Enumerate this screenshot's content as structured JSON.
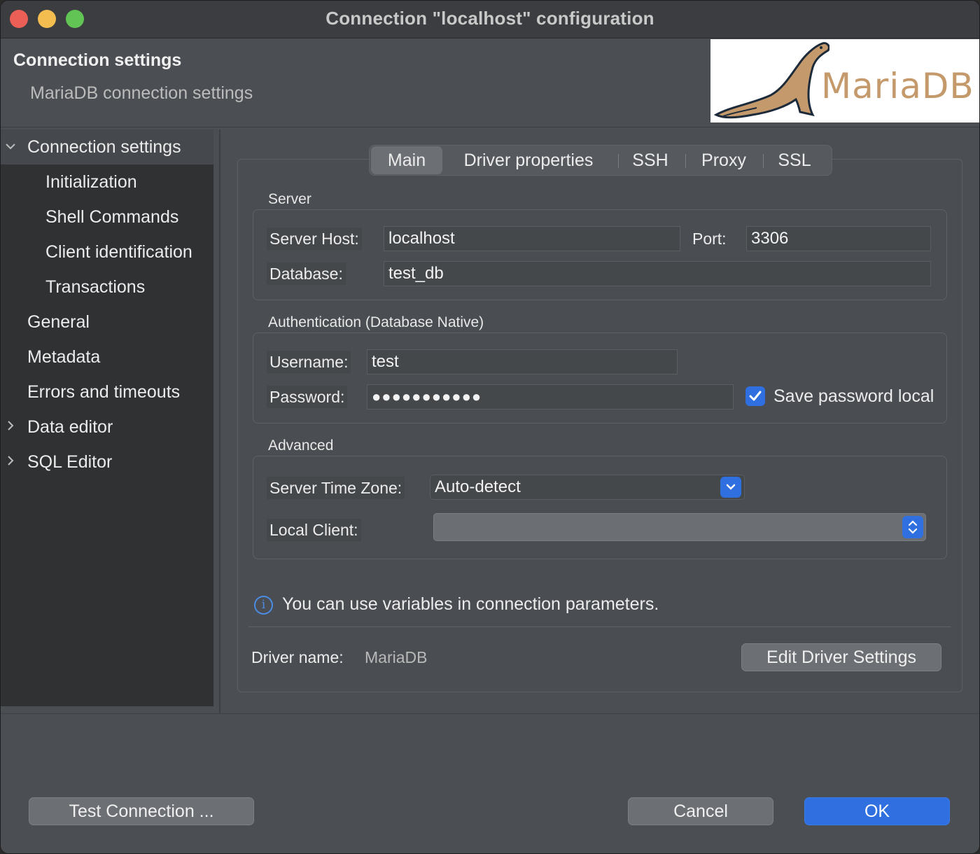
{
  "window": {
    "title": "Connection \"localhost\" configuration"
  },
  "header": {
    "title": "Connection settings",
    "subtitle": "MariaDB connection settings",
    "logo_text": "MariaDB"
  },
  "sidebar": {
    "items": [
      {
        "label": "Connection settings",
        "expander": "expanded",
        "selected": true
      },
      {
        "label": "Initialization"
      },
      {
        "label": "Shell Commands"
      },
      {
        "label": "Client identification"
      },
      {
        "label": "Transactions"
      },
      {
        "label": "General"
      },
      {
        "label": "Metadata"
      },
      {
        "label": "Errors and timeouts"
      },
      {
        "label": "Data editor",
        "expander": "collapsed"
      },
      {
        "label": "SQL Editor",
        "expander": "collapsed"
      }
    ]
  },
  "tabs": [
    "Main",
    "Driver properties",
    "SSH",
    "Proxy",
    "SSL"
  ],
  "active_tab": "Main",
  "server": {
    "section": "Server",
    "host_label": "Server Host:",
    "host_value": "localhost",
    "port_label": "Port:",
    "port_value": "3306",
    "database_label": "Database:",
    "database_value": "test_db"
  },
  "auth": {
    "section": "Authentication (Database Native)",
    "username_label": "Username:",
    "username_value": "test",
    "password_label": "Password:",
    "password_value": "●●●●●●●●●●●",
    "save_password_label": "Save password locally",
    "save_password_checked": true
  },
  "advanced": {
    "section": "Advanced",
    "timezone_label": "Server Time Zone:",
    "timezone_value": "Auto-detect",
    "local_client_label": "Local Client:",
    "local_client_value": ""
  },
  "info_text": "You can use variables in connection parameters.",
  "driver": {
    "label": "Driver name:",
    "value": "MariaDB",
    "edit_button": "Edit Driver Settings"
  },
  "footer": {
    "test_button": "Test Connection ...",
    "cancel_button": "Cancel",
    "ok_button": "OK"
  },
  "colors": {
    "accent": "#2f6fe0",
    "close": "#ec5f57",
    "minimize": "#f3bd4f",
    "maximize": "#61c454"
  },
  "icons": {
    "logo": "mariadb-seal-logo",
    "info": "info-icon",
    "checkbox": "checkmark-icon"
  }
}
